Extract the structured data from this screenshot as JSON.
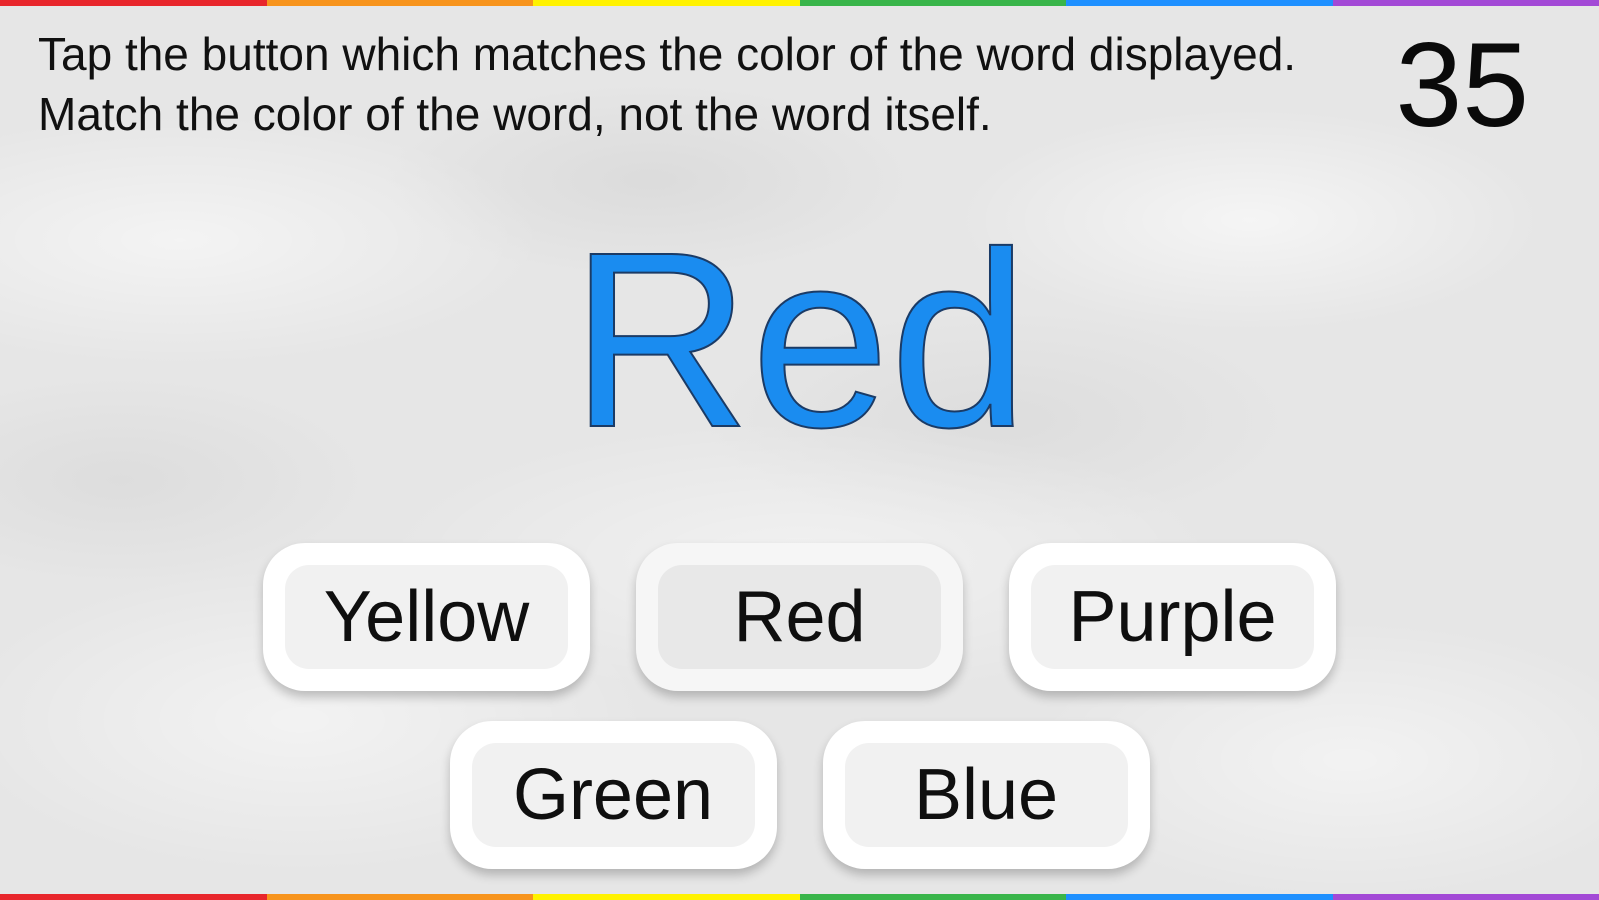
{
  "instructions": "Tap the button which matches the color of the word displayed. Match the color of the word, not the word itself.",
  "timer": "35",
  "stimulus": {
    "word": "Red",
    "color": "#1a8cf0"
  },
  "buttons": {
    "yellow": "Yellow",
    "red": "Red",
    "purple": "Purple",
    "green": "Green",
    "blue": "Blue"
  },
  "rainbow_colors": [
    "#e8262c",
    "#f7941d",
    "#fff200",
    "#39b54a",
    "#1e90ff",
    "#a349d6"
  ]
}
